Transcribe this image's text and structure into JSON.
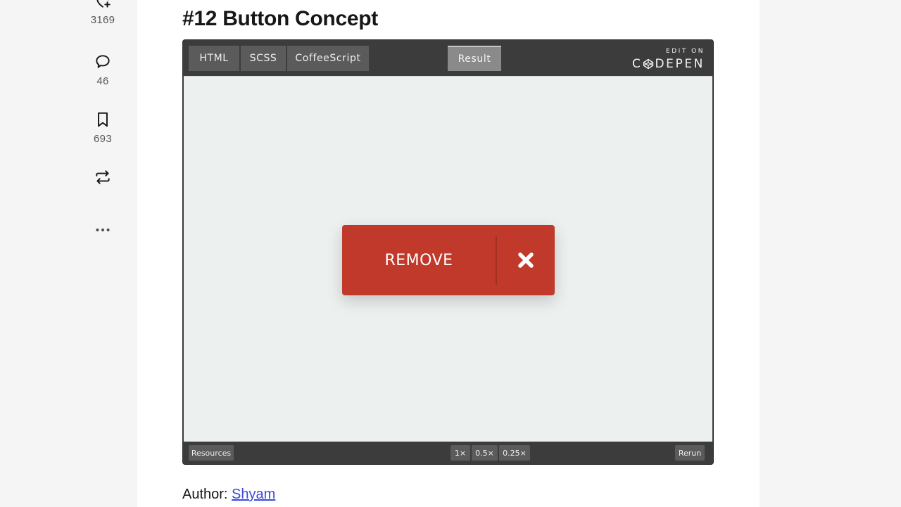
{
  "reactions": {
    "hearts": {
      "icon": "heart-plus-icon",
      "count": "3169"
    },
    "comments": {
      "icon": "comment-icon",
      "count": "46"
    },
    "saves": {
      "icon": "bookmark-icon",
      "count": "693"
    },
    "share": {
      "icon": "repost-icon"
    },
    "more": {
      "icon": "more-icon"
    }
  },
  "article": {
    "title": "#12 Button Concept",
    "author_label": "Author:",
    "author_name": "Shyam"
  },
  "codepen": {
    "tabs": [
      "HTML",
      "SCSS",
      "CoffeeScript"
    ],
    "result_tab": "Result",
    "brand_edit_on": "EDIT ON",
    "brand_word_prefix": "C",
    "brand_word_suffix": "DEPEN",
    "demo_button_label": "REMOVE",
    "resources_label": "Resources",
    "zoom_options": [
      "1×",
      "0.5×",
      "0.25×"
    ],
    "rerun_label": "Rerun",
    "colors": {
      "demo_button": "#c0392b",
      "result_bg": "#ecf0ef",
      "chrome": "#3c3c3c"
    }
  }
}
